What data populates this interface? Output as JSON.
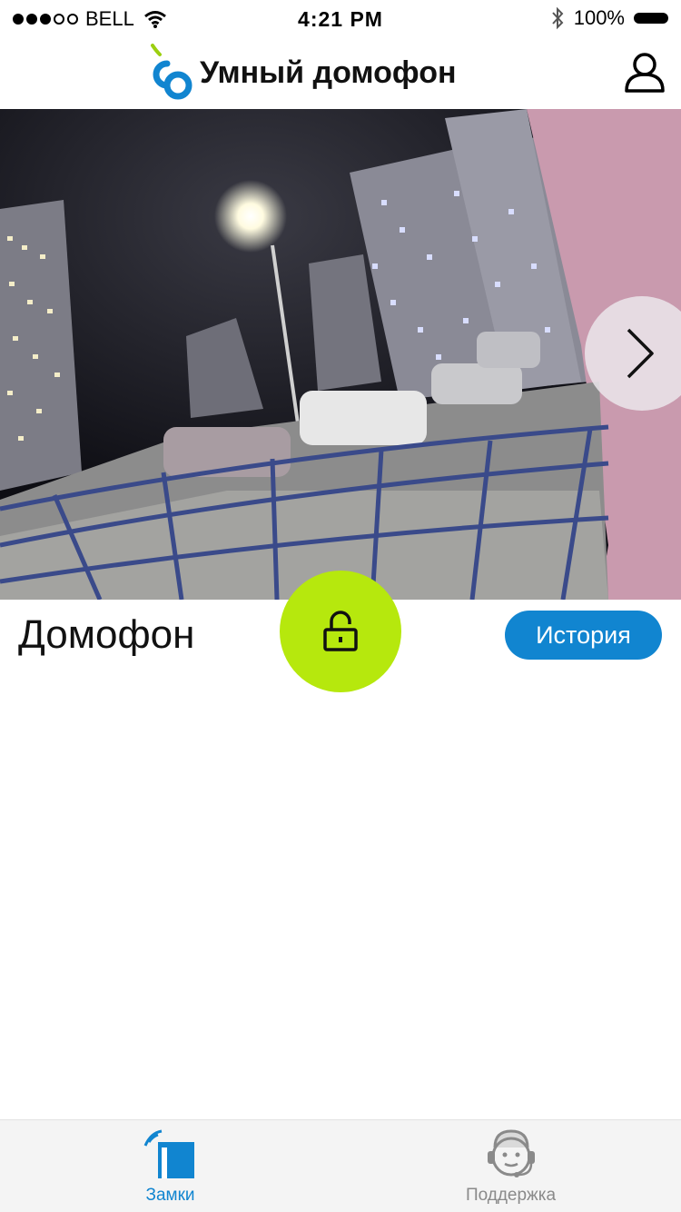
{
  "status_bar": {
    "carrier": "BELL",
    "time": "4:21 PM",
    "battery": "100%"
  },
  "header": {
    "app_title": "Умный домофон"
  },
  "camera": {
    "next_icon": "chevron-right-icon"
  },
  "door": {
    "title": "Домофон",
    "unlock_icon": "unlock-icon",
    "history_label": "История"
  },
  "tabbar": {
    "tabs": [
      {
        "label": "Замки",
        "icon": "door-lock-icon",
        "active": true
      },
      {
        "label": "Поддержка",
        "icon": "support-agent-icon",
        "active": false
      }
    ]
  },
  "colors": {
    "accent": "#1185d0",
    "unlock": "#b6e80d",
    "logo_green": "#9ccf10"
  }
}
